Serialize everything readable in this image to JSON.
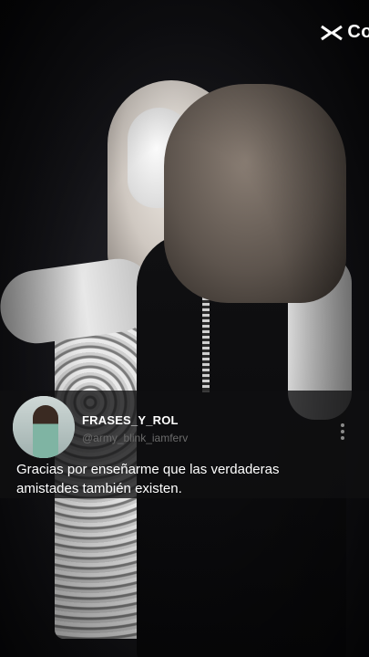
{
  "brand": {
    "text": "Co",
    "icon": "capcut-logo-icon"
  },
  "comment": {
    "username": "FRASES_Y_ROL",
    "handle": "@army_blink_iamferv",
    "text_lines": [
      "Gracias por enseñarme que las verdaderas",
      "amistades también existen."
    ],
    "more_icon": "more-vertical-icon"
  }
}
